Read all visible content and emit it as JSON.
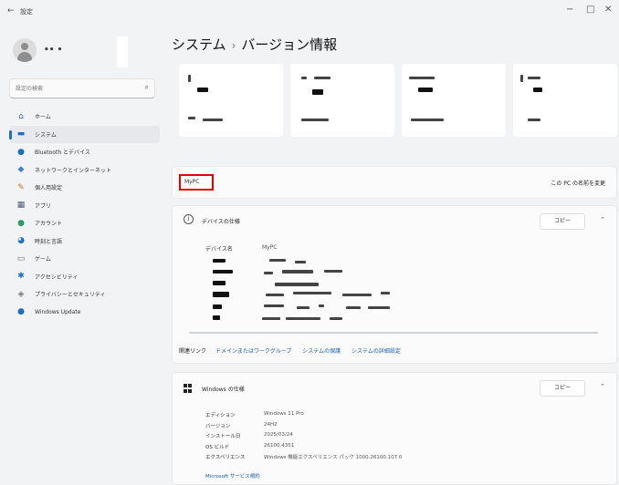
{
  "window": {
    "back_icon": "back-arrow-icon",
    "title": "設定",
    "min_glyph": "−",
    "max_glyph": "□",
    "close_glyph": "✕"
  },
  "profile": {
    "name": "•• •"
  },
  "search": {
    "placeholder": "設定の検索",
    "icon": "search-icon"
  },
  "sidebar": {
    "items": [
      {
        "label": "ホーム",
        "icon": "home-icon",
        "glyph": "⌂",
        "color": "#2c5fa8"
      },
      {
        "label": "システム",
        "icon": "monitor-icon",
        "glyph": "▬",
        "color": "#1a6fc2",
        "active": true
      },
      {
        "label": "Bluetooth とデバイス",
        "icon": "bluetooth-icon",
        "glyph": "●",
        "color": "#1a6fc2"
      },
      {
        "label": "ネットワークとインターネット",
        "icon": "wifi-icon",
        "glyph": "◆",
        "color": "#4a7fc6"
      },
      {
        "label": "個人用設定",
        "icon": "pen-icon",
        "glyph": "✎",
        "color": "#c9761d"
      },
      {
        "label": "アプリ",
        "icon": "apps-icon",
        "glyph": "▦",
        "color": "#4a5c7a"
      },
      {
        "label": "アカウント",
        "icon": "account-icon",
        "glyph": "●",
        "color": "#2d9c63"
      },
      {
        "label": "時刻と言語",
        "icon": "globe-clock-icon",
        "glyph": "◕",
        "color": "#1a6fc2"
      },
      {
        "label": "ゲーム",
        "icon": "gamepad-icon",
        "glyph": "▭",
        "color": "#666666"
      },
      {
        "label": "アクセシビリティ",
        "icon": "accessibility-icon",
        "glyph": "✱",
        "color": "#1a6fc2"
      },
      {
        "label": "プライバシーとセキュリティ",
        "icon": "shield-icon",
        "glyph": "◈",
        "color": "#777777"
      },
      {
        "label": "Windows Update",
        "icon": "windows-update-icon",
        "glyph": "●",
        "color": "#1a6fc2"
      }
    ]
  },
  "main": {
    "breadcrumb_parent": "システム",
    "breadcrumb_sep": "›",
    "title": "バージョン情報",
    "device_name": "MyPC",
    "rename_label": "この PC の名前を変更",
    "device_specs": {
      "title": "デバイスの仕様",
      "copy_label": "コピー",
      "device_name_label": "デバイス名",
      "device_name_value": "MyPC"
    },
    "related": {
      "label": "関連リンク",
      "links": [
        "ドメインまたはワークグループ",
        "システムの保護",
        "システムの詳細設定"
      ]
    },
    "windows_specs": {
      "title": "Windows の仕様",
      "copy_label": "コピー",
      "rows": [
        {
          "key": "エディション",
          "value": "Windows 11 Pro"
        },
        {
          "key": "バージョン",
          "value": "24H2"
        },
        {
          "key": "インストール日",
          "value": "2025/03/24"
        },
        {
          "key": "OS ビルド",
          "value": "26100.4351"
        },
        {
          "key": "エクスペリエンス",
          "value": "Windows 機能エクスペリエンス パック 1000.26100.107.0"
        }
      ],
      "link": "Microsoft サービス規約"
    }
  }
}
